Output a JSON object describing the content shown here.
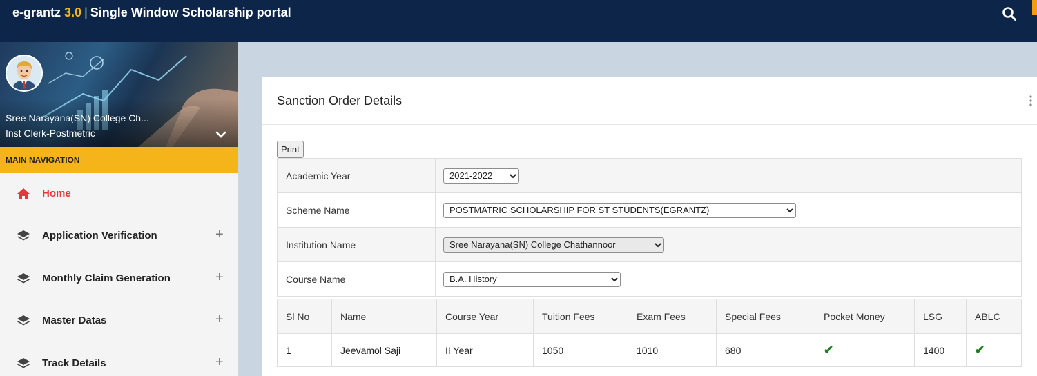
{
  "header": {
    "brand_name": "e-grantz",
    "brand_version": "3.0",
    "brand_separator": "|",
    "portal_title": "Single Window Scholarship portal",
    "search_icon": "search-icon",
    "colors": {
      "bar": "#0c2548",
      "accent": "#f4b41a"
    }
  },
  "sidebar": {
    "user": {
      "institution": "Sree Narayana(SN) College Ch...",
      "role": "Inst Clerk-Postmetric"
    },
    "nav_header": "MAIN NAVIGATION",
    "items": [
      {
        "label": "Home",
        "icon": "home-icon",
        "active": true
      },
      {
        "label": "Application Verification",
        "icon": "layers-icon",
        "expand": "+"
      },
      {
        "label": "Monthly Claim Generation",
        "icon": "layers-icon",
        "expand": "+"
      },
      {
        "label": "Master Datas",
        "icon": "layers-icon",
        "expand": "+"
      },
      {
        "label": "Track Details",
        "icon": "layers-icon",
        "expand": "+"
      }
    ]
  },
  "main": {
    "title": "Sanction Order Details",
    "print_label": "Print",
    "form": {
      "academic_year_label": "Academic Year",
      "academic_year_value": "2021-2022",
      "scheme_label": "Scheme Name",
      "scheme_value": "POSTMATRIC SCHOLARSHIP FOR ST STUDENTS(EGRANTZ)",
      "institution_label": "Institution Name",
      "institution_value": "Sree Narayana(SN) College Chathannoor",
      "course_label": "Course Name",
      "course_value": "B.A. History"
    },
    "table": {
      "columns": [
        "Sl No",
        "Name",
        "Course Year",
        "Tuition Fees",
        "Exam Fees",
        "Special Fees",
        "Pocket Money",
        "LSG",
        "ABLC"
      ],
      "rows": [
        {
          "sl_no": "1",
          "name": "Jeevamol Saji",
          "course_year": "II Year",
          "tuition_fees": "1050",
          "exam_fees": "1010",
          "special_fees": "680",
          "pocket_money": "✔",
          "lsg": "1400",
          "ablc": "✔"
        }
      ]
    }
  }
}
